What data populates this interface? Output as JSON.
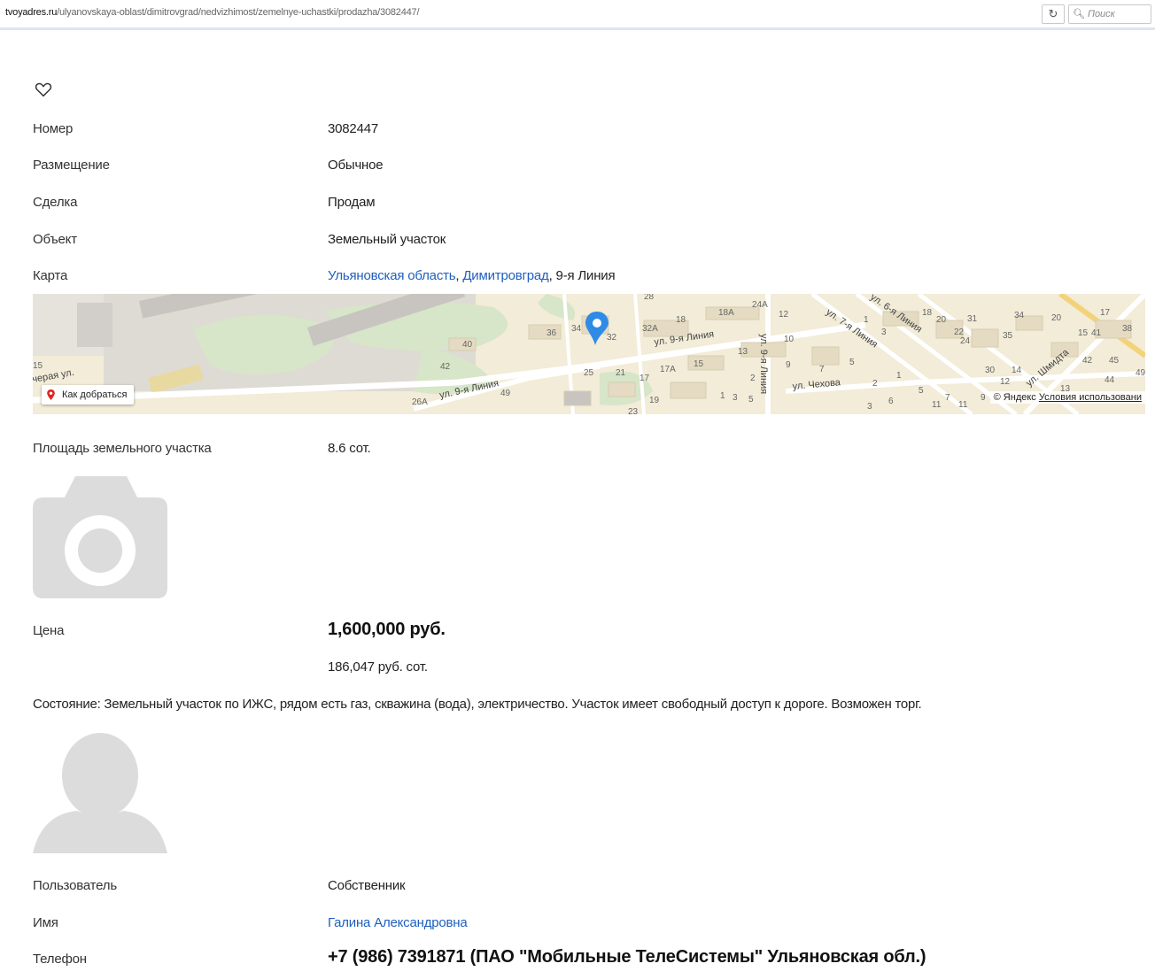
{
  "browser": {
    "url_domain": "tvoyadres.ru",
    "url_path": "/ulyanovskaya-oblast/dimitrovgrad/nedvizhimost/zemelnye-uchastki/prodazha/3082447/",
    "reload_symbol": "C",
    "search_placeholder": "Поиск"
  },
  "favorite": {
    "icon": "heart-icon"
  },
  "fields": {
    "number": {
      "label": "Номер",
      "value": "3082447"
    },
    "placement": {
      "label": "Размещение",
      "value": "Обычное"
    },
    "deal": {
      "label": "Сделка",
      "value": "Продам"
    },
    "object": {
      "label": "Объект",
      "value": "Земельный участок"
    },
    "map": {
      "label": "Карта",
      "region": "Ульяновская область",
      "city": "Димитровград",
      "street": "9-я Линия",
      "sep1": ", ",
      "sep2": ", "
    },
    "area": {
      "label": "Площадь земельного участка",
      "value": "8.6 сот."
    },
    "price": {
      "label": "Цена",
      "value": "1,600,000 руб.",
      "per_unit": "186,047 руб. сот."
    },
    "description": "Состояние: Земельный участок по ИЖС, рядом есть газ, скважина (вода), электричество. Участок имеет свободный доступ к дороге. Возможен торг.",
    "user": {
      "label": "Пользователь",
      "value": "Собственник"
    },
    "name": {
      "label": "Имя",
      "value": "Галина Александровна"
    },
    "phone": {
      "label": "Телефон",
      "value": "+7 (986) 7391871 (ПАО \"Мобильные ТелеСистемы\" Ульяновская обл.)"
    }
  },
  "map_widget": {
    "directions_label": "Как добраться",
    "copyright": "© Яндекс",
    "terms_link": "Условия использовани",
    "street_labels": [
      "ул. 9-я Линия",
      "ул. 9-я Линия",
      "ул. 9-я Линия",
      "ул. 7-я Линия",
      "ул. 6-я Линия",
      "ул. Чехова",
      "ул. Шмидта"
    ],
    "house_numbers": [
      "15",
      "40",
      "42",
      "26А",
      "49",
      "36",
      "34",
      "32",
      "32А",
      "18",
      "18А",
      "24А",
      "12",
      "10",
      "13",
      "9",
      "7",
      "5",
      "3",
      "1",
      "25",
      "21",
      "17",
      "17А",
      "15",
      "19",
      "23",
      "2",
      "1",
      "3",
      "5",
      "28",
      "18",
      "20",
      "22",
      "24",
      "31",
      "34",
      "35",
      "20",
      "17",
      "15",
      "41",
      "38",
      "42",
      "45",
      "44",
      "49",
      "30",
      "14",
      "12",
      "13",
      "11",
      "9",
      "7",
      "5",
      "3",
      "1",
      "6",
      "2",
      "3",
      "11"
    ],
    "colors": {
      "background": "#f2ecd8",
      "road": "#ffffff",
      "park": "#d7e5c8",
      "building": "#e4dbc2",
      "marker": "#2f8be6"
    }
  },
  "placeholders": {
    "photo": "camera-icon",
    "avatar": "user-avatar-icon"
  }
}
